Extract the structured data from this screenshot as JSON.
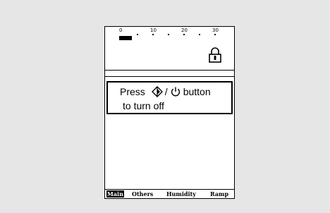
{
  "scale": {
    "ticks": [
      "0",
      "10",
      "20",
      "30"
    ],
    "level": 0.14
  },
  "message": {
    "prefix": "Press",
    "slash": "/",
    "suffix": "button",
    "line2": "to turn off"
  },
  "icons": {
    "lock": "lock-icon",
    "start_stop": "start-stop-icon",
    "power": "power-icon"
  },
  "tabs": [
    {
      "label": "Main",
      "active": true
    },
    {
      "label": "Others",
      "active": false
    },
    {
      "label": "Humidity",
      "active": false
    },
    {
      "label": "Ramp",
      "active": false
    }
  ],
  "colors": {
    "background": "#e6e6e6",
    "screen": "#ffffff",
    "ink": "#000000"
  }
}
